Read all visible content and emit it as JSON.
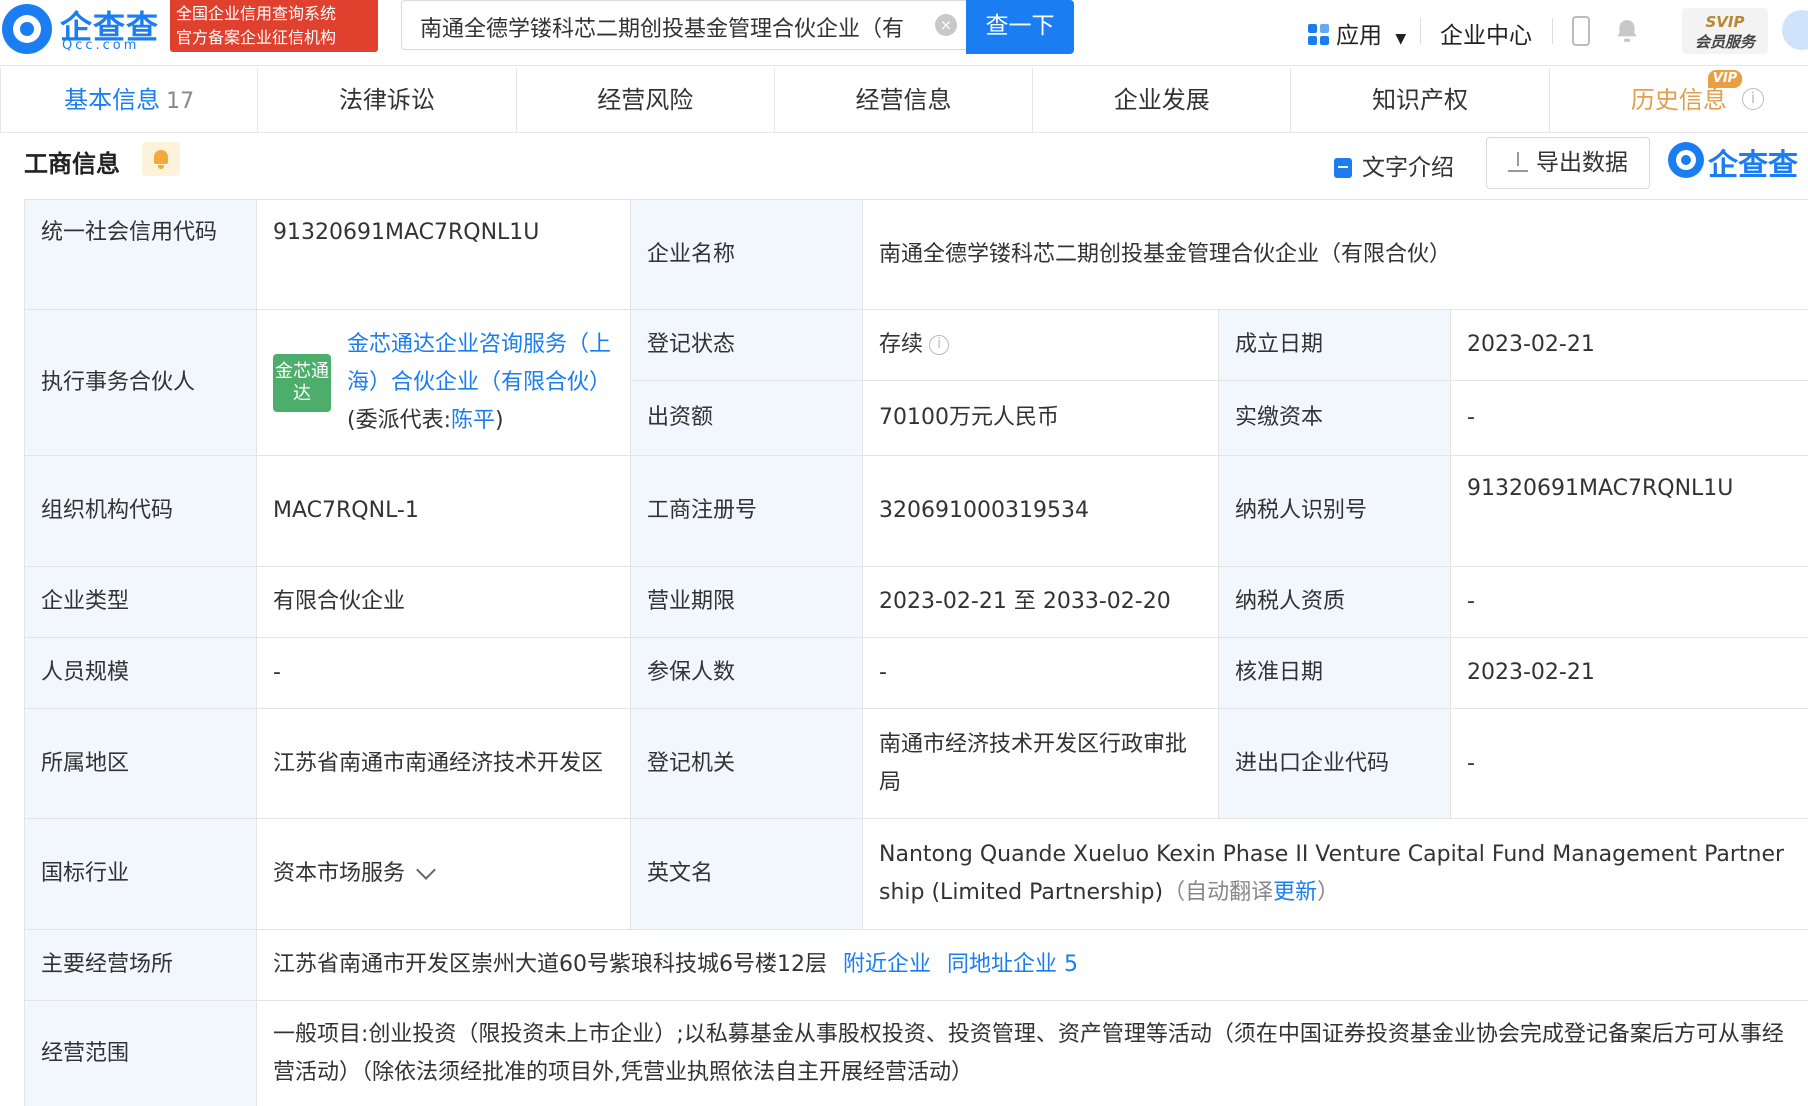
{
  "header": {
    "logo_cn": "企查查",
    "logo_en": "Qcc.com",
    "badge_line1": "全国企业信用查询系统",
    "badge_line2": "官方备案企业征信机构",
    "search_value": "南通全德学镂科芯二期创投基金管理合伙企业（有",
    "search_button": "查一下",
    "apps_label": "应用",
    "enterprise_center": "企业中心",
    "svip_line1": "SVIP",
    "svip_line2": "会员服务"
  },
  "tabs": [
    {
      "label": "基本信息",
      "count": "17"
    },
    {
      "label": "法律诉讼"
    },
    {
      "label": "经营风险"
    },
    {
      "label": "经营信息"
    },
    {
      "label": "企业发展"
    },
    {
      "label": "知识产权"
    },
    {
      "label": "历史信息",
      "tag": "VIP"
    }
  ],
  "section": {
    "title": "工商信息",
    "text_intro": "文字介绍",
    "export": "导出数据",
    "watermark": "企查查"
  },
  "info": {
    "credit_code_label": "统一社会信用代码",
    "credit_code": "91320691MAC7RQNL1U",
    "company_name_label": "企业名称",
    "company_name": "南通全德学镂科芯二期创投基金管理合伙企业（有限合伙）",
    "partner_label": "执行事务合伙人",
    "partner_logo": "金芯通达",
    "partner_name": "金芯通达企业咨询服务（上海）合伙企业（有限合伙）",
    "partner_rep_prefix": "(委派代表:",
    "partner_rep": "陈平",
    "partner_rep_suffix": ")",
    "status_label": "登记状态",
    "status": "存续",
    "established_label": "成立日期",
    "established": "2023-02-21",
    "capital_label": "出资额",
    "capital": "70100万元人民币",
    "paid_capital_label": "实缴资本",
    "paid_capital": "-",
    "org_code_label": "组织机构代码",
    "org_code": "MAC7RQNL-1",
    "reg_no_label": "工商注册号",
    "reg_no": "320691000319534",
    "taxpayer_id_label": "纳税人识别号",
    "taxpayer_id": "91320691MAC7RQNL1U",
    "type_label": "企业类型",
    "type": "有限合伙企业",
    "term_label": "营业期限",
    "term": "2023-02-21 至 2033-02-20",
    "taxpayer_qual_label": "纳税人资质",
    "taxpayer_qual": "-",
    "staff_label": "人员规模",
    "staff": "-",
    "insured_label": "参保人数",
    "insured": "-",
    "approval_label": "核准日期",
    "approval": "2023-02-21",
    "region_label": "所属地区",
    "region": "江苏省南通市南通经济技术开发区",
    "authority_label": "登记机关",
    "authority": "南通市经济技术开发区行政审批局",
    "import_export_label": "进出口企业代码",
    "import_export": "-",
    "industry_label": "国标行业",
    "industry": "资本市场服务",
    "english_label": "英文名",
    "english": "Nantong Quande Xueluo Kexin Phase II Venture Capital Fund Management Partnership (Limited Partnership)",
    "auto_translate": "（自动翻译",
    "update_link": "更新",
    "auto_translate_end": "）",
    "address_label": "主要经营场所",
    "address": "江苏省南通市开发区崇州大道60号紫琅科技城6号楼12层",
    "nearby_link": "附近企业",
    "same_address_link": "同地址企业 5",
    "scope_label": "经营范围",
    "scope": "一般项目:创业投资（限投资未上市企业）;以私募基金从事股权投资、投资管理、资产管理等活动（须在中国证券投资基金业协会完成登记备案后方可从事经营活动）（除依法须经批准的项目外,凭营业执照依法自主开展经营活动）"
  }
}
